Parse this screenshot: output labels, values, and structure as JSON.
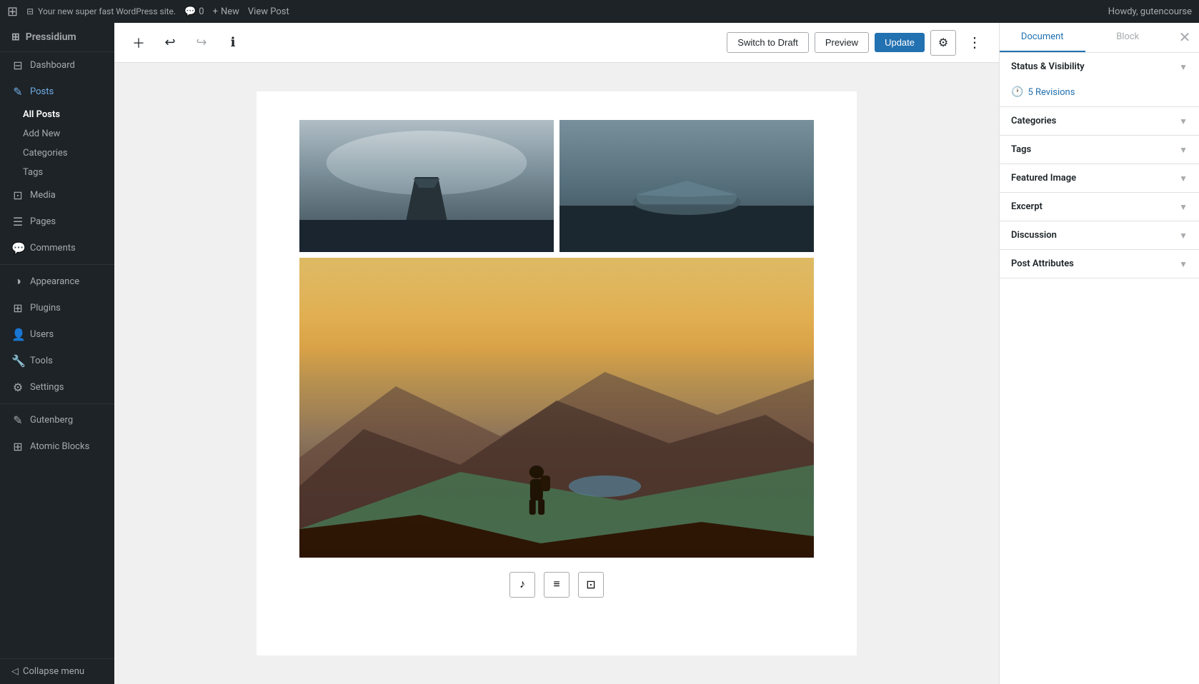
{
  "adminbar": {
    "wp_icon": "⊞",
    "site_name": "Your new super fast WordPress site.",
    "comments_icon": "💬",
    "comments_count": "0",
    "new_icon": "+",
    "new_label": "New",
    "view_post_label": "View Post",
    "howdy_label": "Howdy, gutencourse"
  },
  "sidebar": {
    "brand_icon": "⊞",
    "brand_name": "Pressidium",
    "items": [
      {
        "id": "dashboard",
        "icon": "⊟",
        "label": "Dashboard"
      },
      {
        "id": "posts",
        "icon": "✎",
        "label": "Posts",
        "active": true
      },
      {
        "id": "media",
        "icon": "⊡",
        "label": "Media"
      },
      {
        "id": "pages",
        "icon": "☰",
        "label": "Pages"
      },
      {
        "id": "comments",
        "icon": "💬",
        "label": "Comments"
      },
      {
        "id": "appearance",
        "icon": "◑",
        "label": "Appearance"
      },
      {
        "id": "plugins",
        "icon": "⊞",
        "label": "Plugins"
      },
      {
        "id": "users",
        "icon": "👤",
        "label": "Users"
      },
      {
        "id": "tools",
        "icon": "🔧",
        "label": "Tools"
      },
      {
        "id": "settings",
        "icon": "⚙",
        "label": "Settings"
      },
      {
        "id": "gutenberg",
        "icon": "✎",
        "label": "Gutenberg"
      },
      {
        "id": "atomic-blocks",
        "icon": "⊞",
        "label": "Atomic Blocks"
      }
    ],
    "post_subitems": [
      {
        "id": "all-posts",
        "label": "All Posts",
        "active": true
      },
      {
        "id": "add-new",
        "label": "Add New"
      },
      {
        "id": "categories",
        "label": "Categories"
      },
      {
        "id": "tags",
        "label": "Tags"
      }
    ],
    "collapse_label": "Collapse menu"
  },
  "toolbar": {
    "add_block_label": "+",
    "undo_label": "↩",
    "redo_label": "↪",
    "info_label": "ℹ",
    "switch_draft_label": "Switch to Draft",
    "preview_label": "Preview",
    "update_label": "Update",
    "settings_label": "⚙",
    "more_label": "⋮"
  },
  "panel": {
    "document_tab": "Document",
    "block_tab": "Block",
    "close_icon": "✕",
    "sections": [
      {
        "id": "status-visibility",
        "label": "Status & Visibility"
      },
      {
        "id": "revisions",
        "label": "Revisions",
        "has_revisions": true,
        "revision_count": "5 Revisions"
      },
      {
        "id": "categories",
        "label": "Categories"
      },
      {
        "id": "tags",
        "label": "Tags"
      },
      {
        "id": "featured-image",
        "label": "Featured Image"
      },
      {
        "id": "excerpt",
        "label": "Excerpt"
      },
      {
        "id": "discussion",
        "label": "Discussion"
      },
      {
        "id": "post-attributes",
        "label": "Post Attributes"
      }
    ]
  },
  "block_toolbar": {
    "audio_icon": "♪",
    "list_icon": "≡",
    "image_icon": "⊡"
  },
  "images": {
    "road_alt": "Road in snowy landscape",
    "plane_alt": "Crashed plane on dark beach",
    "mountain_alt": "Hiker in mountain landscape"
  }
}
